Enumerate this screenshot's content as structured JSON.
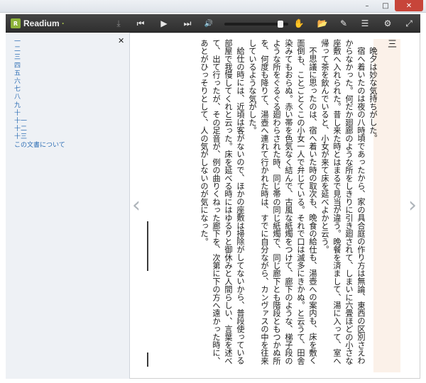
{
  "window": {
    "min": "–",
    "max": "□",
    "close": "✕"
  },
  "toolbar": {
    "app_name": "Readium",
    "app_name_dot": "·",
    "logo_mark": "R",
    "icons": {
      "download": "⤓",
      "prev": "⏮",
      "play": "▶",
      "next": "⏭",
      "volume": "🔊",
      "audio_settings": "✋",
      "library": "📂",
      "edit": "✎",
      "toc": "☰",
      "settings": "⚙",
      "fullscreen": "⤢"
    },
    "volume_level": 0.92
  },
  "toc": {
    "close": "✕",
    "items": [
      "一",
      "二",
      "三",
      "四",
      "五",
      "六",
      "七",
      "八",
      "九",
      "十",
      "十一",
      "十二",
      "十三",
      "この文書について"
    ]
  },
  "nav": {
    "prev": "‹",
    "next": "›"
  },
  "content": {
    "chapter": "三",
    "paragraphs": [
      "晩夕は妙な気持ちがした。",
      "宿へ着いたのは夜の八時頃であったから、家の具合庭の作り方は無論、東西の区別さえわからなかった。何だか廻廊のような所をしきりに引き廻されて、しまいに六畳ほどの小さな座敷へ入れられた。昔し来た時とはまるで見当が違う。晩餐を済まして、湯に入って、室へ帰って茶を飲んでいると、小女が来て床を延べよかと云う。",
      "不思議に思ったのは、宿へ着いた時の取次も、晩食の給仕も、湯壺への案内も、床を敷く面倒も、ことごとくこの小女一人で弁じている。それで口は滅多にきかぬ。と云うて、田舎染みてもおらぬ。赤い帯を色気なく結んで、古風な紙燭をつけて、廊下のような、梯子段のような所をぐるぐる廻わらされた時、同じ帯の同じ紙燭で、同じ廊下とも階段ともつかぬ所を、何度も降りて、湯壺へ連れて行かれた時は、すでに自分ながら、カンヴァスの中を往来しているような気がした。",
      "給仕の時には、近頃は客がないので、ほかの座敷は掃除がしてないから、普段使っている部屋で我慢してくれと云った。床を延べる時にはゆるりと御休みと人間らしい、言葉を述べて、出て行ったが、その足音が、例の曲りくねった廊下を、次第に下の方へ遠かった時に、あとがひっそりとして、人の気がしないのが気になった。"
    ]
  }
}
